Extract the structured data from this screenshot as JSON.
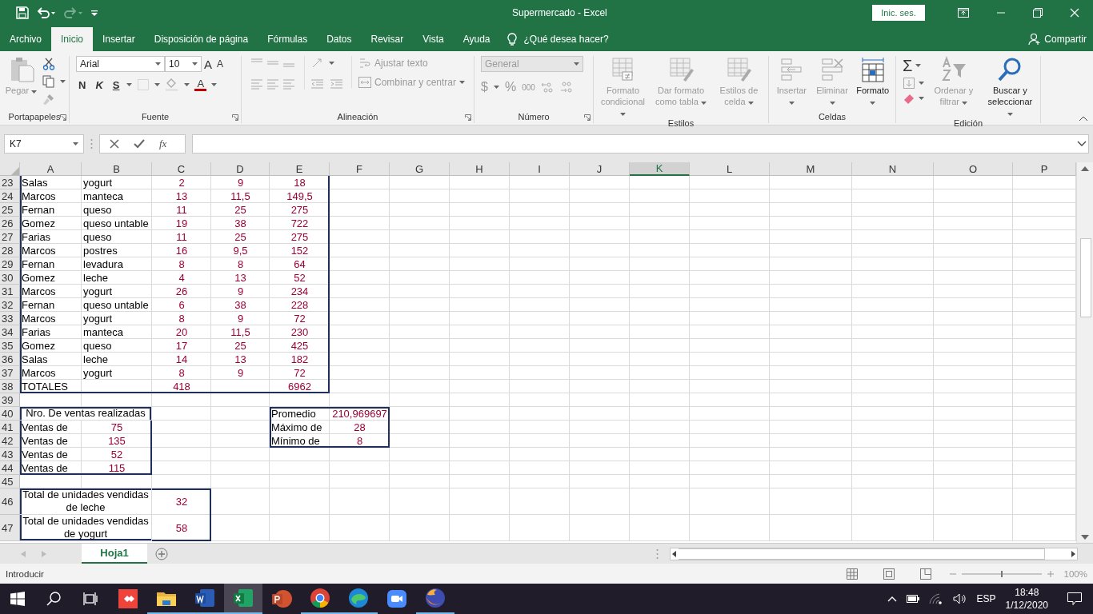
{
  "window": {
    "title": "Supermercado  -  Excel",
    "sign_in": "Inic. ses."
  },
  "menu_tabs": [
    {
      "label": "Archivo",
      "selected": false
    },
    {
      "label": "Inicio",
      "selected": true
    },
    {
      "label": "Insertar",
      "selected": false
    },
    {
      "label": "Disposición de página",
      "selected": false
    },
    {
      "label": "Fórmulas",
      "selected": false
    },
    {
      "label": "Datos",
      "selected": false
    },
    {
      "label": "Revisar",
      "selected": false
    },
    {
      "label": "Vista",
      "selected": false
    },
    {
      "label": "Ayuda",
      "selected": false
    }
  ],
  "tell_me": "¿Qué desea hacer?",
  "share": "Compartir",
  "ribbon": {
    "clipboard": {
      "label": "Portapapeles",
      "paste": {
        "label": "Pegar",
        "disabled": true
      }
    },
    "font": {
      "label": "Fuente",
      "family": "Arial",
      "size": "10",
      "grow": "A",
      "shrink": "A",
      "bold": "N",
      "italic": "K",
      "underline": "S",
      "color_button": "A"
    },
    "alignment": {
      "label": "Alineación",
      "wrap": {
        "label": "Ajustar texto",
        "disabled": true
      },
      "merge": {
        "label": "Combinar y centrar",
        "disabled": true
      }
    },
    "number": {
      "label": "Número",
      "format": {
        "value": "General",
        "disabled": true
      },
      "currency": "$",
      "percent": "%",
      "thousands": "000"
    },
    "styles": {
      "label": "Estilos",
      "buttons": [
        {
          "label": "Formato condicional",
          "disabled": true
        },
        {
          "label": "Dar formato como tabla",
          "disabled": true
        },
        {
          "label": "Estilos de celda",
          "disabled": true
        }
      ]
    },
    "cells": {
      "label": "Celdas",
      "buttons": [
        {
          "label": "Insertar",
          "disabled": true
        },
        {
          "label": "Eliminar",
          "disabled": true
        },
        {
          "label": "Formato",
          "disabled": false
        }
      ]
    },
    "editing": {
      "label": "Edición",
      "autosum": "Σ",
      "buttons": [
        {
          "label": "Ordenar y filtrar",
          "disabled": true
        },
        {
          "label": "Buscar y seleccionar",
          "disabled": false
        }
      ]
    }
  },
  "formula_bar": {
    "name_box": "K7",
    "function_label": "fx"
  },
  "sheet": {
    "columns": [
      {
        "label": "A",
        "selected": false
      },
      {
        "label": "B",
        "selected": false
      },
      {
        "label": "C",
        "selected": false
      },
      {
        "label": "D",
        "selected": false
      },
      {
        "label": "E",
        "selected": false
      },
      {
        "label": "F",
        "selected": false
      },
      {
        "label": "G",
        "selected": false
      },
      {
        "label": "H",
        "selected": false
      },
      {
        "label": "I",
        "selected": false
      },
      {
        "label": "J",
        "selected": false
      },
      {
        "label": "K",
        "selected": true
      },
      {
        "label": "L",
        "selected": false
      },
      {
        "label": "M",
        "selected": false
      },
      {
        "label": "N",
        "selected": false
      },
      {
        "label": "O",
        "selected": false
      },
      {
        "label": "P",
        "selected": false
      }
    ],
    "rows": [
      {
        "number": "23",
        "cells": [
          {
            "text": "Salas",
            "kind": "text"
          },
          {
            "text": "yogurt",
            "kind": "text"
          },
          {
            "text": "2",
            "kind": "number"
          },
          {
            "text": "9",
            "kind": "number"
          },
          {
            "text": "18",
            "kind": "number"
          }
        ]
      },
      {
        "number": "24",
        "cells": [
          {
            "text": "Marcos",
            "kind": "text"
          },
          {
            "text": "manteca",
            "kind": "text"
          },
          {
            "text": "13",
            "kind": "number"
          },
          {
            "text": "11,5",
            "kind": "number"
          },
          {
            "text": "149,5",
            "kind": "number"
          }
        ]
      },
      {
        "number": "25",
        "cells": [
          {
            "text": "Fernan",
            "kind": "text"
          },
          {
            "text": "queso",
            "kind": "text"
          },
          {
            "text": "11",
            "kind": "number"
          },
          {
            "text": "25",
            "kind": "number"
          },
          {
            "text": "275",
            "kind": "number"
          }
        ]
      },
      {
        "number": "26",
        "cells": [
          {
            "text": "Gomez",
            "kind": "text"
          },
          {
            "text": "queso untable",
            "kind": "text"
          },
          {
            "text": "19",
            "kind": "number"
          },
          {
            "text": "38",
            "kind": "number"
          },
          {
            "text": "722",
            "kind": "number"
          }
        ]
      },
      {
        "number": "27",
        "cells": [
          {
            "text": "Farias",
            "kind": "text"
          },
          {
            "text": "queso",
            "kind": "text"
          },
          {
            "text": "11",
            "kind": "number"
          },
          {
            "text": "25",
            "kind": "number"
          },
          {
            "text": "275",
            "kind": "number"
          }
        ]
      },
      {
        "number": "28",
        "cells": [
          {
            "text": "Marcos",
            "kind": "text"
          },
          {
            "text": "postres",
            "kind": "text"
          },
          {
            "text": "16",
            "kind": "number"
          },
          {
            "text": "9,5",
            "kind": "number"
          },
          {
            "text": "152",
            "kind": "number"
          }
        ]
      },
      {
        "number": "29",
        "cells": [
          {
            "text": "Fernan",
            "kind": "text"
          },
          {
            "text": "levadura",
            "kind": "text"
          },
          {
            "text": "8",
            "kind": "number"
          },
          {
            "text": "8",
            "kind": "number"
          },
          {
            "text": "64",
            "kind": "number"
          }
        ]
      },
      {
        "number": "30",
        "cells": [
          {
            "text": "Gomez",
            "kind": "text"
          },
          {
            "text": "leche",
            "kind": "text"
          },
          {
            "text": "4",
            "kind": "number"
          },
          {
            "text": "13",
            "kind": "number"
          },
          {
            "text": "52",
            "kind": "number"
          }
        ]
      },
      {
        "number": "31",
        "cells": [
          {
            "text": "Marcos",
            "kind": "text"
          },
          {
            "text": "yogurt",
            "kind": "text"
          },
          {
            "text": "26",
            "kind": "number"
          },
          {
            "text": "9",
            "kind": "number"
          },
          {
            "text": "234",
            "kind": "number"
          }
        ]
      },
      {
        "number": "32",
        "cells": [
          {
            "text": "Fernan",
            "kind": "text"
          },
          {
            "text": "queso untable",
            "kind": "text"
          },
          {
            "text": "6",
            "kind": "number"
          },
          {
            "text": "38",
            "kind": "number"
          },
          {
            "text": "228",
            "kind": "number"
          }
        ]
      },
      {
        "number": "33",
        "cells": [
          {
            "text": "Marcos",
            "kind": "text"
          },
          {
            "text": "yogurt",
            "kind": "text"
          },
          {
            "text": "8",
            "kind": "number"
          },
          {
            "text": "9",
            "kind": "number"
          },
          {
            "text": "72",
            "kind": "number"
          }
        ]
      },
      {
        "number": "34",
        "cells": [
          {
            "text": "Farias",
            "kind": "text"
          },
          {
            "text": "manteca",
            "kind": "text"
          },
          {
            "text": "20",
            "kind": "number"
          },
          {
            "text": "11,5",
            "kind": "number"
          },
          {
            "text": "230",
            "kind": "number"
          }
        ]
      },
      {
        "number": "35",
        "cells": [
          {
            "text": "Gomez",
            "kind": "text"
          },
          {
            "text": "queso",
            "kind": "text"
          },
          {
            "text": "17",
            "kind": "number"
          },
          {
            "text": "25",
            "kind": "number"
          },
          {
            "text": "425",
            "kind": "number"
          }
        ]
      },
      {
        "number": "36",
        "cells": [
          {
            "text": "Salas",
            "kind": "text"
          },
          {
            "text": "leche",
            "kind": "text"
          },
          {
            "text": "14",
            "kind": "number"
          },
          {
            "text": "13",
            "kind": "number"
          },
          {
            "text": "182",
            "kind": "number"
          }
        ]
      },
      {
        "number": "37",
        "cells": [
          {
            "text": "Marcos",
            "kind": "text"
          },
          {
            "text": "yogurt",
            "kind": "text"
          },
          {
            "text": "8",
            "kind": "number"
          },
          {
            "text": "9",
            "kind": "number"
          },
          {
            "text": "72",
            "kind": "number"
          }
        ]
      },
      {
        "number": "38",
        "cells": [
          {
            "text": "TOTALES",
            "kind": "text"
          },
          null,
          {
            "text": "418",
            "kind": "number"
          },
          null,
          {
            "text": "6962",
            "kind": "number"
          }
        ]
      },
      {
        "number": "39",
        "cells": []
      },
      {
        "number": "40",
        "cells": [
          {
            "text": "Nro. De ventas realizadas",
            "kind": "merged"
          },
          null,
          null,
          null,
          {
            "text": "Promedio",
            "kind": "text"
          },
          {
            "text": "210,969697",
            "kind": "number"
          }
        ]
      },
      {
        "number": "41",
        "cells": [
          {
            "text": "Ventas de",
            "kind": "text"
          },
          {
            "text": "75",
            "kind": "number"
          },
          null,
          null,
          {
            "text": "Máximo de",
            "kind": "text"
          },
          {
            "text": "28",
            "kind": "number"
          }
        ]
      },
      {
        "number": "42",
        "cells": [
          {
            "text": "Ventas de",
            "kind": "text"
          },
          {
            "text": "135",
            "kind": "number"
          },
          null,
          null,
          {
            "text": "Mínimo de",
            "kind": "text"
          },
          {
            "text": "8",
            "kind": "number"
          }
        ]
      },
      {
        "number": "43",
        "cells": [
          {
            "text": "Ventas de",
            "kind": "text"
          },
          {
            "text": "52",
            "kind": "number"
          }
        ]
      },
      {
        "number": "44",
        "cells": [
          {
            "text": "Ventas de",
            "kind": "text"
          },
          {
            "text": "115",
            "kind": "number"
          }
        ]
      },
      {
        "number": "45",
        "cells": []
      },
      {
        "number": "46",
        "cells": [
          {
            "text": "Total de unidades vendidas de leche",
            "kind": "merged"
          },
          null,
          {
            "text": "32",
            "kind": "number"
          }
        ]
      },
      {
        "number": "47",
        "cells": [
          {
            "text": "Total de unidades vendidas de yogurt",
            "kind": "merged"
          },
          null,
          {
            "text": "58",
            "kind": "number"
          }
        ]
      }
    ]
  },
  "sheet_tabs": [
    {
      "label": "Hoja1",
      "selected": true
    }
  ],
  "status_bar": {
    "mode": "Introducir",
    "zoom": "100%",
    "zoom_slider": {
      "level": 0.5
    }
  },
  "taskbar": {
    "apps": [
      {
        "kind": "diamond",
        "running": false,
        "selected": false
      },
      {
        "kind": "folder",
        "running": true,
        "selected": false
      },
      {
        "kind": "word",
        "running": true,
        "selected": false
      },
      {
        "kind": "excel",
        "running": true,
        "selected": true
      },
      {
        "kind": "slides",
        "running": false,
        "selected": false
      },
      {
        "kind": "chrome",
        "running": true,
        "selected": false
      },
      {
        "kind": "edge",
        "running": true,
        "selected": false
      },
      {
        "kind": "camera",
        "running": false,
        "selected": false
      },
      {
        "kind": "fox",
        "running": true,
        "selected": false
      }
    ],
    "language": "ESP",
    "time": "18:48",
    "date": "1/12/2020"
  }
}
